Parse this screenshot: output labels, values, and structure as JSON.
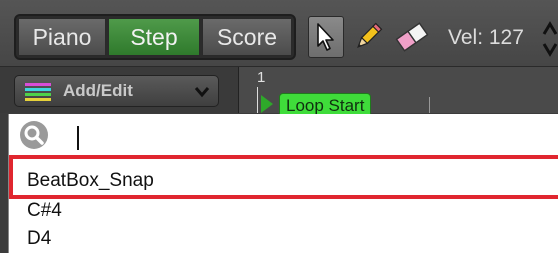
{
  "toolbar": {
    "modes": [
      {
        "label": "Piano",
        "active": false
      },
      {
        "label": "Step",
        "active": true
      },
      {
        "label": "Score",
        "active": false
      }
    ],
    "tools": [
      "cursor-icon",
      "pencil-icon",
      "eraser-icon"
    ],
    "velocity_label": "Vel: 127"
  },
  "row2": {
    "add_edit_label": "Add/Edit",
    "bar_number": "1",
    "loop_start_label": "Loop Start"
  },
  "dropdown": {
    "search_value": "",
    "items": [
      "BeatBox_Snap",
      "C#4",
      "D4"
    ],
    "highlighted_index": 0
  },
  "colors": {
    "active_mode": "#3a8a36",
    "loop_marker": "#3fdc3a",
    "highlight_border": "#e0262f"
  }
}
